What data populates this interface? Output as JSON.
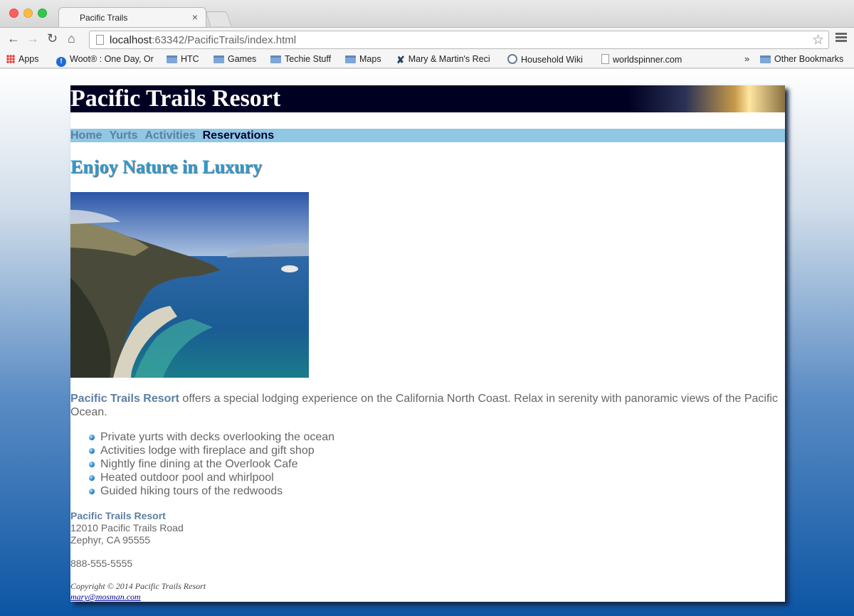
{
  "browser": {
    "tab_title": "Pacific Trails",
    "tab_close": "×",
    "url_host": "localhost",
    "url_rest": ":63342/PacificTrails/index.html",
    "bookmarks": [
      {
        "label": "Apps",
        "icon": "apps-icon"
      },
      {
        "label": "Woot® : One Day, Or",
        "icon": "woot-icon"
      },
      {
        "label": "HTC",
        "icon": "folder-icon"
      },
      {
        "label": "Games",
        "icon": "folder-icon"
      },
      {
        "label": "Techie Stuff",
        "icon": "folder-icon"
      },
      {
        "label": "Maps",
        "icon": "folder-icon"
      },
      {
        "label": "Mary & Martin's Reci",
        "icon": "recipes-icon"
      },
      {
        "label": "Household Wiki",
        "icon": "household-wiki-icon"
      },
      {
        "label": "worldspinner.com",
        "icon": "page-icon"
      },
      {
        "label": "Other Bookmarks",
        "icon": "folder-icon"
      }
    ],
    "bookmarks_overflow": "»"
  },
  "page": {
    "site_title": "Pacific Trails Resort",
    "nav": [
      "Home",
      "Yurts",
      "Activities",
      "Reservations"
    ],
    "heading": "Enjoy Nature in Luxury",
    "intro_brand": "Pacific Trails Resort",
    "intro_text": " offers a special lodging experience on the California North Coast. Relax in serenity with panoramic views of the Pacific Ocean.",
    "features": [
      "Private yurts with decks overlooking the ocean",
      "Activities lodge with fireplace and gift shop",
      "Nightly fine dining at the Overlook Cafe",
      "Heated outdoor pool and whirlpool",
      "Guided hiking tours of the redwoods"
    ],
    "contact": {
      "name": "Pacific Trails Resort",
      "street": "12010 Pacific Trails Road",
      "city": "Zephyr, CA 95555",
      "phone": "888-555-5555"
    },
    "footer": {
      "copyright": "Copyright © 2014 Pacific Trails Resort",
      "email": "mary@mosman.com"
    }
  },
  "colors": {
    "header_bg": "#000022",
    "nav_bg": "#90c7e3",
    "nav_link": "#5c7fa3",
    "nav_current": "#000033",
    "heading": "#3399cc",
    "text": "#666666",
    "link": "#000099"
  }
}
